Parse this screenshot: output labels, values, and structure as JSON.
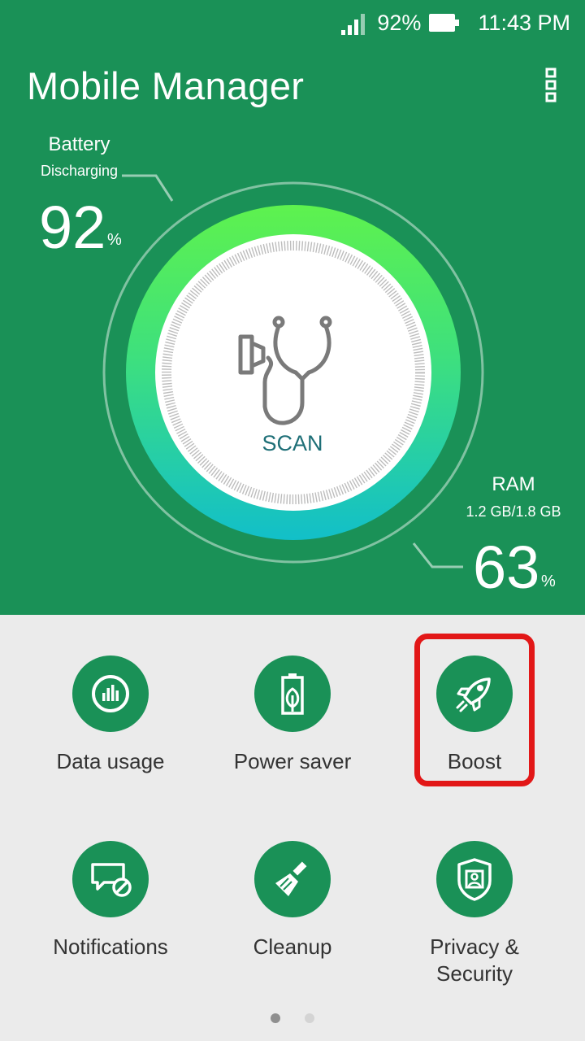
{
  "status_bar": {
    "battery_percent": "92%",
    "time": "11:43 PM"
  },
  "header": {
    "title": "Mobile Manager"
  },
  "battery": {
    "label": "Battery",
    "state": "Discharging",
    "value": "92",
    "unit": "%"
  },
  "ram": {
    "label": "RAM",
    "usage": "1.2 GB/1.8 GB",
    "value": "63",
    "unit": "%"
  },
  "scan": {
    "label": "SCAN"
  },
  "tools": [
    {
      "label": "Data usage",
      "icon": "bar-chart-icon"
    },
    {
      "label": "Power saver",
      "icon": "battery-leaf-icon"
    },
    {
      "label": "Boost",
      "icon": "rocket-icon"
    },
    {
      "label": "Notifications",
      "icon": "notification-block-icon"
    },
    {
      "label": "Cleanup",
      "icon": "broom-icon"
    },
    {
      "label": "Privacy & Security",
      "icon": "shield-user-icon"
    }
  ],
  "pager": {
    "current_page": 1,
    "total_pages": 2
  },
  "colors": {
    "primary_green": "#1a9157",
    "highlight_red": "#e21717",
    "scan_text": "#1e6f77"
  }
}
